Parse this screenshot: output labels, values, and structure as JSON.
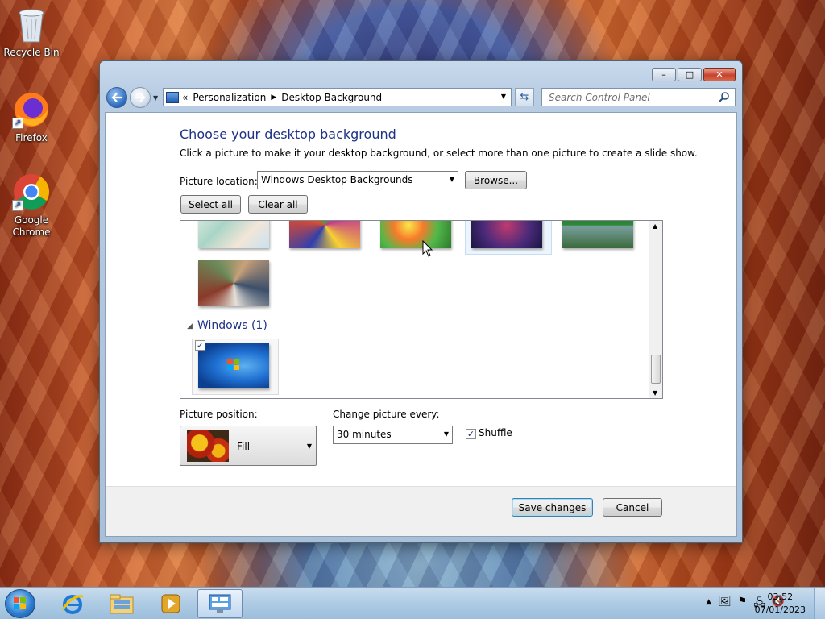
{
  "desktop": {
    "icons": [
      {
        "label": "Recycle Bin"
      },
      {
        "label": "Firefox"
      },
      {
        "label": "Google Chrome"
      }
    ]
  },
  "window": {
    "controls": {
      "minimize": "–",
      "maximize": "□",
      "close": "✕"
    },
    "address": {
      "prefix": "«",
      "crumbs": [
        "Personalization",
        "Desktop Background"
      ]
    },
    "search": {
      "placeholder": "Search Control Panel"
    },
    "heading": "Choose your desktop background",
    "description": "Click a picture to make it your desktop background, or select more than one picture to create a slide show.",
    "picture_location": {
      "label": "Picture location:",
      "value": "Windows Desktop Backgrounds"
    },
    "browse_label": "Browse...",
    "select_all_label": "Select all",
    "clear_all_label": "Clear all",
    "group": {
      "name": "Windows (1)"
    },
    "picture_position": {
      "label": "Picture position:",
      "value": "Fill"
    },
    "change_every": {
      "label": "Change picture every:",
      "value": "30 minutes"
    },
    "shuffle": {
      "label": "Shuffle",
      "checked": true
    },
    "save_label": "Save changes",
    "cancel_label": "Cancel"
  },
  "taskbar": {
    "time": "03:52",
    "date": "07/01/2023"
  }
}
